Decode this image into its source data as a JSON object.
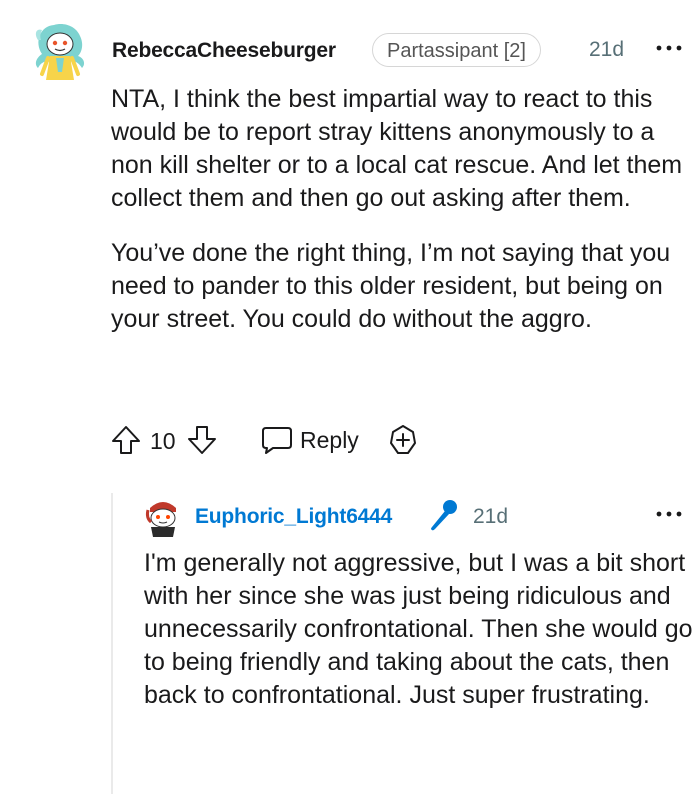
{
  "comment": {
    "author": "RebeccaCheeseburger",
    "flair": "Partassipant [2]",
    "time": "21d",
    "paragraphs": [
      "NTA, I think the best impartial way to react to this would be to report stray kittens anonymously to a non kill shelter or to a local cat rescue. And let them collect them and then go out asking after them.",
      "You’ve done the right thing, I’m not saying that you need to pander to this older resident, but being on your street. You could do without the aggro."
    ],
    "score": "10",
    "reply_label": "Reply"
  },
  "reply": {
    "author": "Euphoric_Light6444",
    "time": "21d",
    "text": "I'm generally not aggressive, but I was a bit short with her since she was just being ridiculous and unnecessarily confrontational. Then she would go to being friendly and taking about the cats, then back to confrontational. Just super frustrating."
  },
  "colors": {
    "link": "#0079d3",
    "meta": "#576f76",
    "text": "#1a1a1b"
  },
  "icons": [
    "snoo-avatar",
    "more-options-icon",
    "upvote-icon",
    "downvote-icon",
    "reply-bubble-icon",
    "award-icon",
    "microphone-icon"
  ]
}
